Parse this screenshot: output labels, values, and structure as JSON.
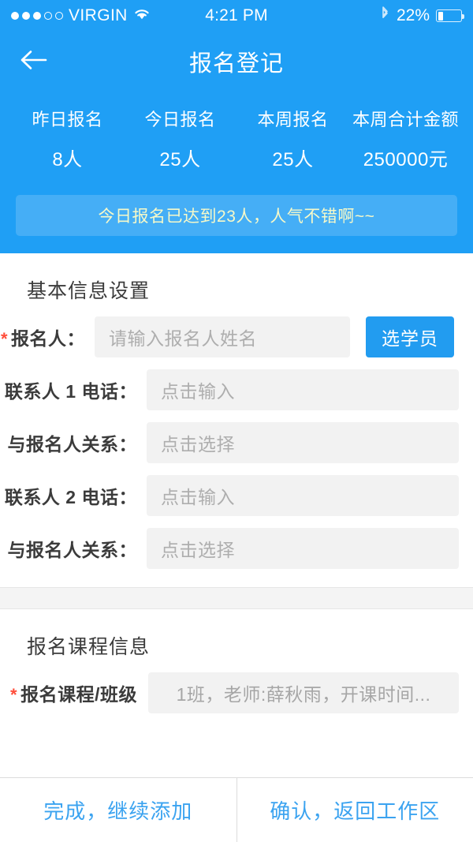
{
  "statusbar": {
    "carrier": "VIRGIN",
    "signal_filled": 3,
    "signal_empty": 2,
    "wifi_icon": "wifi-icon",
    "time": "4:21 PM",
    "bluetooth_icon": "bluetooth-icon",
    "battery_percent": "22%",
    "battery_level": 22
  },
  "navbar": {
    "back_icon": "back-arrow-icon",
    "title": "报名登记"
  },
  "stats": [
    {
      "label": "昨日报名",
      "value": "8人"
    },
    {
      "label": "今日报名",
      "value": "25人"
    },
    {
      "label": "本周报名",
      "value": "25人"
    },
    {
      "label": "本周合计金额",
      "value": "250000元"
    }
  ],
  "banner": {
    "text": "今日报名已达到23人，人气不错啊~~"
  },
  "basic_section": {
    "title": "基本信息设置",
    "applicant": {
      "required_mark": "*",
      "label": "报名人：",
      "placeholder": "请输入报名人姓名",
      "value": "",
      "pick_button": "选学员"
    },
    "rows": [
      {
        "label": "联系人 1 电话：",
        "placeholder": "点击输入",
        "value": ""
      },
      {
        "label": "与报名人关系：",
        "placeholder": "点击选择",
        "value": ""
      },
      {
        "label": "联系人 2 电话：",
        "placeholder": "点击输入",
        "value": ""
      },
      {
        "label": "与报名人关系：",
        "placeholder": "点击选择",
        "value": ""
      }
    ]
  },
  "course_section": {
    "title": "报名课程信息",
    "course": {
      "required_mark": "*",
      "label": "报名课程/班级",
      "value": "1班，老师:薛秋雨，开课时间..."
    }
  },
  "bottombar": {
    "left_button": "完成，继续添加",
    "right_button": "确认，返回工作区"
  },
  "colors": {
    "header_blue": "#1f9ff5",
    "banner_blue": "#45aef6",
    "banner_text": "#f6f9c9",
    "accent_blue": "#229cf0",
    "link_blue": "#3ba3f0",
    "required_red": "#ff4d3a",
    "field_gray": "#f2f2f2",
    "placeholder_gray": "#aeaeae"
  }
}
